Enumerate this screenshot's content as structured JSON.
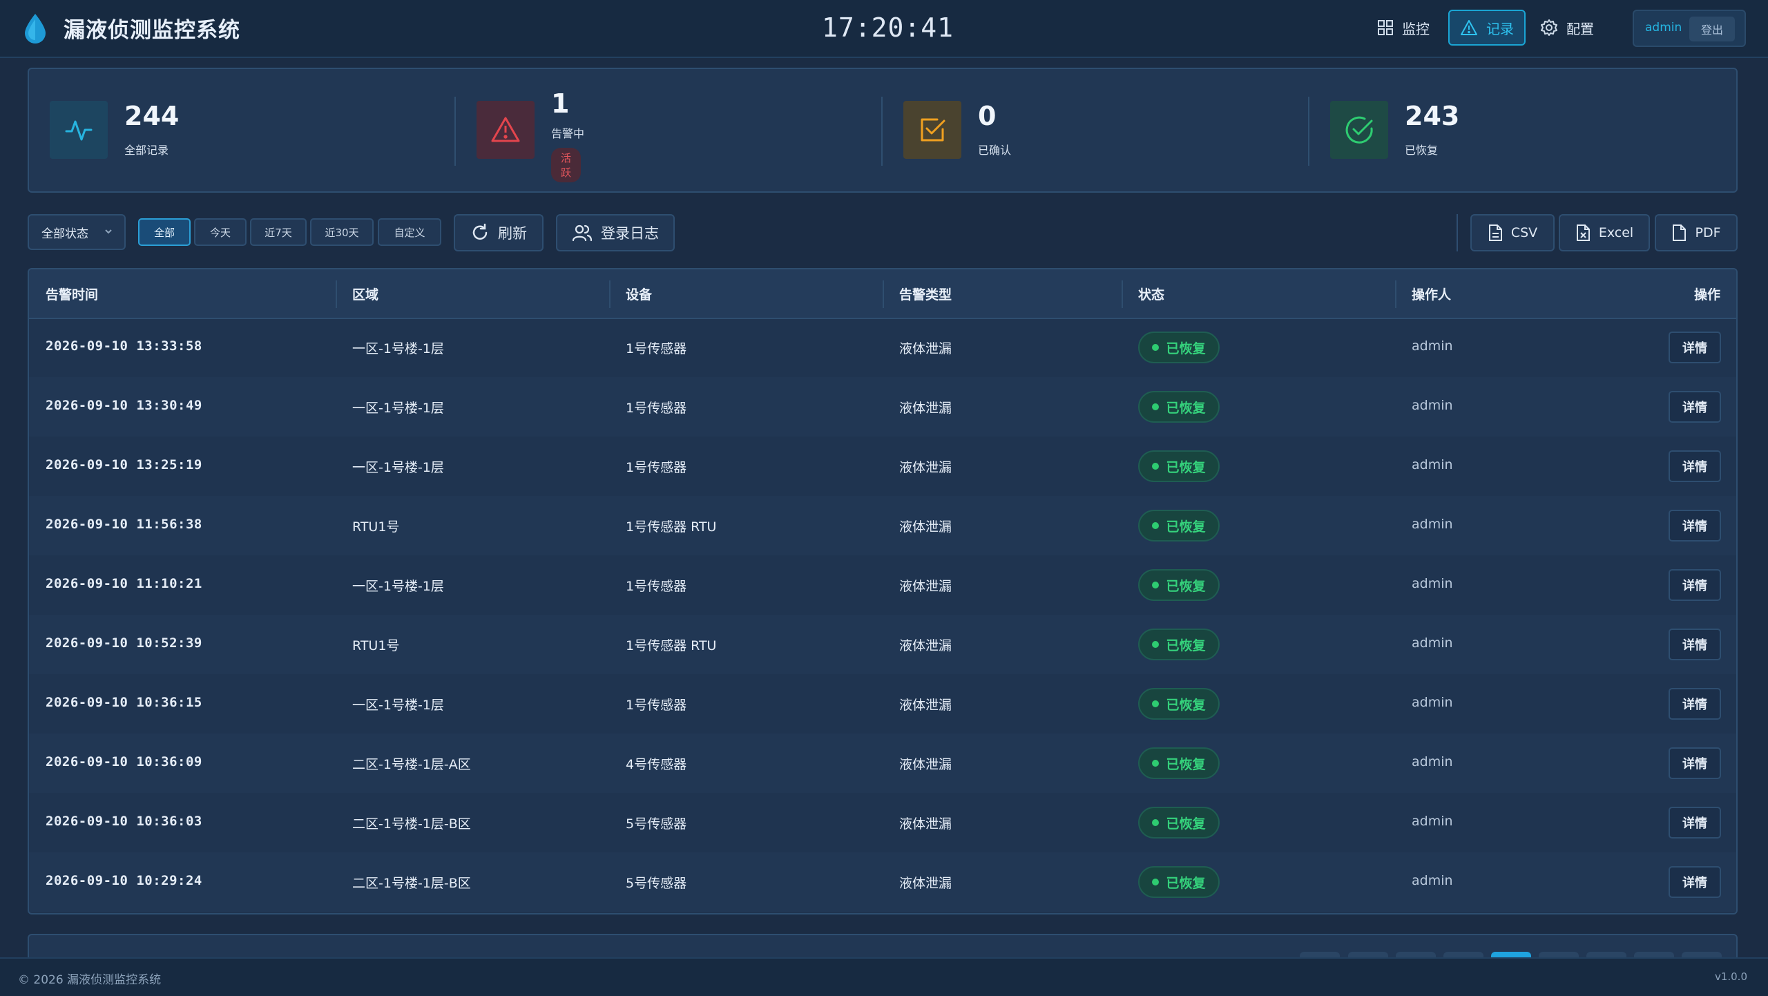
{
  "app": {
    "title": "漏液侦测监控系统",
    "clock": "17:20:41"
  },
  "nav": {
    "monitor_label": "监控",
    "record_label": "记录",
    "config_label": "配置",
    "user_name": "admin",
    "logout_label": "登出"
  },
  "stats": [
    {
      "value": "244",
      "label": "全部记录",
      "icon": "activity-icon",
      "color": "#27b4e0"
    },
    {
      "value": "1",
      "label": "告警中",
      "badge": "活跃",
      "icon": "warning-icon",
      "color": "#e3454d"
    },
    {
      "value": "0",
      "label": "已确认",
      "icon": "check-square-icon",
      "color": "#f0a020"
    },
    {
      "value": "243",
      "label": "已恢复",
      "icon": "check-circle-icon",
      "color": "#2ecc71"
    }
  ],
  "toolbar": {
    "status_filter": "全部状态",
    "ranges": [
      "全部",
      "今天",
      "近7天",
      "近30天",
      "自定义"
    ],
    "active_range": "全部",
    "refresh_label": "刷新",
    "login_log_label": "登录日志",
    "export": [
      "CSV",
      "Excel",
      "PDF"
    ]
  },
  "table": {
    "headers": [
      "告警时间",
      "区域",
      "设备",
      "告警类型",
      "状态",
      "操作人",
      "操作"
    ],
    "detail_label": "详情",
    "rows": [
      {
        "time": "2026-09-10 13:33:58",
        "area": "一区-1号楼-1层",
        "device": "1号传感器",
        "type": "液体泄漏",
        "status": "已恢复",
        "operator": "admin"
      },
      {
        "time": "2026-09-10 13:30:49",
        "area": "一区-1号楼-1层",
        "device": "1号传感器",
        "type": "液体泄漏",
        "status": "已恢复",
        "operator": "admin"
      },
      {
        "time": "2026-09-10 13:25:19",
        "area": "一区-1号楼-1层",
        "device": "1号传感器",
        "type": "液体泄漏",
        "status": "已恢复",
        "operator": "admin"
      },
      {
        "time": "2026-09-10 11:56:38",
        "area": "RTU1号",
        "device": "1号传感器 RTU",
        "type": "液体泄漏",
        "status": "已恢复",
        "operator": "admin"
      },
      {
        "time": "2026-09-10 11:10:21",
        "area": "一区-1号楼-1层",
        "device": "1号传感器",
        "type": "液体泄漏",
        "status": "已恢复",
        "operator": "admin"
      },
      {
        "time": "2026-09-10 10:52:39",
        "area": "RTU1号",
        "device": "1号传感器 RTU",
        "type": "液体泄漏",
        "status": "已恢复",
        "operator": "admin"
      },
      {
        "time": "2026-09-10 10:36:15",
        "area": "一区-1号楼-1层",
        "device": "1号传感器",
        "type": "液体泄漏",
        "status": "已恢复",
        "operator": "admin"
      },
      {
        "time": "2026-09-10 10:36:09",
        "area": "二区-1号楼-1层-A区",
        "device": "4号传感器",
        "type": "液体泄漏",
        "status": "已恢复",
        "operator": "admin"
      },
      {
        "time": "2026-09-10 10:36:03",
        "area": "二区-1号楼-1层-B区",
        "device": "5号传感器",
        "type": "液体泄漏",
        "status": "已恢复",
        "operator": "admin"
      },
      {
        "time": "2026-09-10 10:29:24",
        "area": "二区-1号楼-1层-B区",
        "device": "5号传感器",
        "type": "液体泄漏",
        "status": "已恢复",
        "operator": "admin"
      }
    ]
  },
  "footer": {
    "copyright": "© 2026 漏液侦测监控系统",
    "version": "v1.0.0"
  },
  "colors": {
    "accent": "#1aa5d4",
    "success": "#35d27c",
    "danger": "#e3454d",
    "warning": "#f0a020"
  }
}
